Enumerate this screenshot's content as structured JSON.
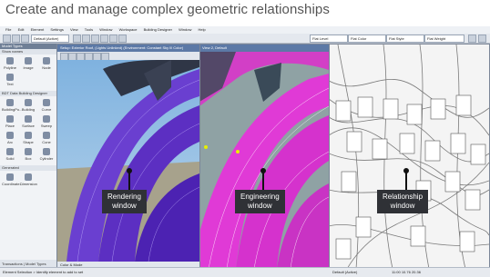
{
  "headline": "Create and manage complex geometric relationships",
  "menu": [
    "File",
    "Edit",
    "Element",
    "Settings",
    "View",
    "Tools",
    "Window",
    "Workspace",
    "Building Designer",
    "Window",
    "Help"
  ],
  "toolbar": {
    "combo_1": "Default (Active)",
    "combo_2": "Flat Level",
    "combo_3": "Flat Color",
    "combo_4": "Flat Style",
    "combo_5": "Flat Weight"
  },
  "palette": {
    "title": "Model Types",
    "subtitle": "Show names",
    "group_1": "BDT Data Building Designer",
    "group_2": "Generated",
    "tools": [
      "Polyline",
      "Image",
      "Node",
      "Text",
      "BuildingPo...",
      "Building",
      "Curve",
      "Place",
      "Surface",
      "Sweep",
      "Arc",
      "Shape",
      "Cone",
      "Solid",
      "Box",
      "Cylinder",
      "Coordinate...",
      "Dimension"
    ],
    "bottom_tabs": "Transactions | Model Types"
  },
  "windows": {
    "render_title": "Setup: Exterior Roof, (Lights Unlinked) (Environment: Constant Sky Ill Color)",
    "engineer_title": "View 2, Default",
    "render_status": "Color & Mode"
  },
  "callouts": {
    "render": "Rendering\nwindow",
    "engineer": "Engineering\nwindow",
    "relationship": "Relationship\nwindow"
  },
  "status": {
    "left": "Element Selection > Identify element to add to set",
    "right": "Default (Active)",
    "coords": "11:00  10.76  20.36"
  }
}
